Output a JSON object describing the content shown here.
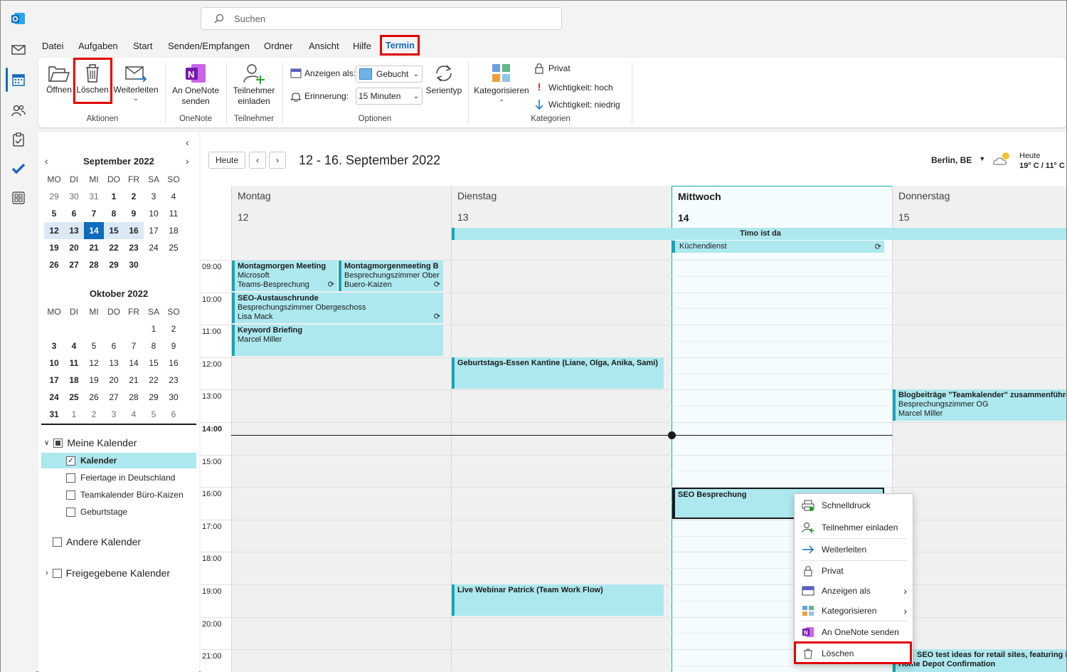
{
  "app": {
    "search_placeholder": "Suchen"
  },
  "nav": [
    "mail-icon",
    "calendar-icon",
    "people-icon",
    "tasks-icon",
    "todo-icon",
    "apps-icon"
  ],
  "menu": {
    "datei": "Datei",
    "aufgaben": "Aufgaben",
    "start": "Start",
    "senden": "Senden/Empfangen",
    "ordner": "Ordner",
    "ansicht": "Ansicht",
    "hilfe": "Hilfe",
    "termin": "Termin"
  },
  "ribbon": {
    "oeffnen": "Öffnen",
    "loeschen": "Löschen",
    "weiterleiten": "Weiterleiten",
    "aktionen": "Aktionen",
    "onenote_l1": "An OneNote",
    "onenote_l2": "senden",
    "onenote_grp": "OneNote",
    "teiln_l1": "Teilnehmer",
    "teiln_l2": "einladen",
    "teiln_grp": "Teilnehmer",
    "anzeigen_als": "Anzeigen als:",
    "anzeigen_val": "Gebucht",
    "erinnerung": "Erinnerung:",
    "erinnerung_val": "15 Minuten",
    "serientyp": "Serientyp",
    "optionen": "Optionen",
    "kategorisieren": "Kategorisieren",
    "privat": "Privat",
    "wichtig_hoch": "Wichtigkeit: hoch",
    "wichtig_niedrig": "Wichtigkeit: niedrig",
    "kategorien": "Kategorien"
  },
  "mini_sep": {
    "title": "September 2022",
    "headers": [
      "MO",
      "DI",
      "MI",
      "DO",
      "FR",
      "SA",
      "SO"
    ],
    "rows": [
      [
        "29",
        "30",
        "31",
        "1",
        "2",
        "3",
        "4"
      ],
      [
        "5",
        "6",
        "7",
        "8",
        "9",
        "10",
        "11"
      ],
      [
        "12",
        "13",
        "14",
        "15",
        "16",
        "17",
        "18"
      ],
      [
        "19",
        "20",
        "21",
        "22",
        "23",
        "24",
        "25"
      ],
      [
        "26",
        "27",
        "28",
        "29",
        "30",
        "",
        ""
      ]
    ]
  },
  "mini_oct": {
    "title": "Oktober 2022",
    "headers": [
      "MO",
      "DI",
      "MI",
      "DO",
      "FR",
      "SA",
      "SO"
    ],
    "rows": [
      [
        "",
        "",
        "",
        "",
        "",
        "1",
        "2"
      ],
      [
        "3",
        "4",
        "5",
        "6",
        "7",
        "8",
        "9"
      ],
      [
        "10",
        "11",
        "12",
        "13",
        "14",
        "15",
        "16"
      ],
      [
        "17",
        "18",
        "19",
        "20",
        "21",
        "22",
        "23"
      ],
      [
        "24",
        "25",
        "26",
        "27",
        "28",
        "29",
        "30"
      ],
      [
        "31",
        "1",
        "2",
        "3",
        "4",
        "5",
        "6"
      ]
    ]
  },
  "calendars": {
    "meine": "Meine Kalender",
    "kalender": "Kalender",
    "feiertage": "Feiertage in Deutschland",
    "team": "Teamkalender Büro-Kaizen",
    "geburtstage": "Geburtstage",
    "andere": "Andere Kalender",
    "freigegeben": "Freigegebene Kalender"
  },
  "toolbar": {
    "heute": "Heute",
    "range": "12 - 16. September 2022",
    "location": "Berlin, BE",
    "weather_label": "Heute",
    "weather_temp": "19° C / 11° C"
  },
  "days": [
    {
      "name": "Montag",
      "date": "12"
    },
    {
      "name": "Dienstag",
      "date": "13"
    },
    {
      "name": "Mittwoch",
      "date": "14"
    },
    {
      "name": "Donnerstag",
      "date": "15"
    }
  ],
  "hours": [
    "09:00",
    "10:00",
    "11:00",
    "12:00",
    "13:00",
    "14:00",
    "15:00",
    "16:00",
    "17:00",
    "18:00",
    "19:00",
    "20:00",
    "21:00"
  ],
  "allday": {
    "timo": "Timo ist da",
    "kuechen": "Küchendienst"
  },
  "events": {
    "e1": {
      "t": "Montagmorgen Meeting",
      "l2": "Microsoft",
      "l3": "Teams-Besprechung"
    },
    "e2": {
      "t": "Montagmorgenmeeting B",
      "l2": "Besprechungszimmer Ober",
      "l3": "Buero-Kaizen"
    },
    "e3": {
      "t": "SEO-Austauschrunde",
      "l2": "Besprechungszimmer Obergeschoss",
      "l3": "Lisa Mack"
    },
    "e4": {
      "t": "Keyword Briefing",
      "l2": "Marcel Miller"
    },
    "e5": {
      "t": "Geburtstags-Essen Kantine (Liane, Olga, Anika, Sami)"
    },
    "e6": {
      "t": "Blogbeiträge \"Teamkalender\" zusammenführen",
      "l2": "Besprechungszimmer OG",
      "l3": "Marcel Miller"
    },
    "e7": {
      "t": "SEO Besprechung"
    },
    "e8": {
      "t": "Live Webinar Patrick (Team Work Flow)"
    },
    "e9": {
      "t": "SEO test ideas for retail sites, featuring Lo",
      "l2": "Home Depot Confirmation"
    }
  },
  "context": {
    "schnelldruck": "Schnelldruck",
    "teilnehmer": "Teilnehmer einladen",
    "weiterleiten": "Weiterleiten",
    "privat": "Privat",
    "anzeigen": "Anzeigen als",
    "kategorisieren": "Kategorisieren",
    "onenote": "An OneNote senden",
    "loeschen": "Löschen"
  },
  "colors": {
    "accent": "#0f6cbd",
    "event_bg": "#ade8ee",
    "event_border": "#16a5b6",
    "highlight": "#e00000"
  }
}
